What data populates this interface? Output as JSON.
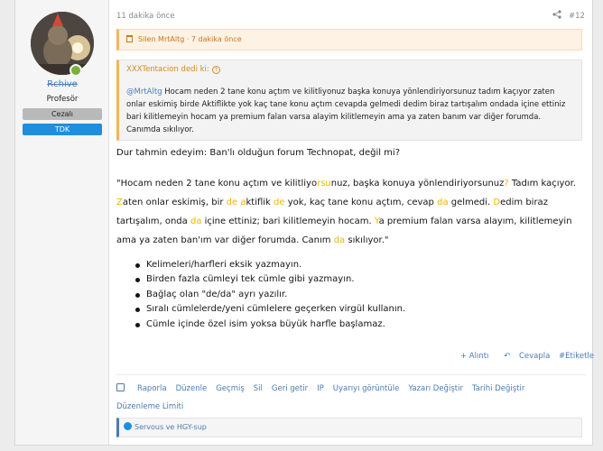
{
  "user": {
    "name": "Rchive",
    "title": "Profesör",
    "banner_banned": "Cezalı",
    "banner_tdk": "TDK"
  },
  "meta": {
    "time": "11 dakika önce",
    "number": "#12"
  },
  "deleted": {
    "text": "Silen MrtAltg · 7 dakika önce"
  },
  "quote": {
    "author": "XXXTentacion dedi ki:",
    "mention": "@MrtAltg",
    "line1": " Hocam neden 2 tane konu açtım ve kilitliyonuz başka konuya yönlendiriyorsunuz tadım kaçıyor zaten",
    "line2": "onlar eskimiş birde Aktiflikte yok kaç tane konu açtım cevapda gelmedi dedim biraz tartışalım ondada içine ettiniz",
    "line3": "bari kilitlemeyin hocam ya premium falan varsa alayim kilitlemeyin ama ya zaten banım var diğer forumda.",
    "line4": "Canımda sıkılıyor."
  },
  "body": {
    "intro": "Dur tahmin edeyim: Ban'lı olduğun forum Technopat, değil mi?",
    "p1": "\"Hocam neden 2 tane konu açtım ve kilitliyo",
    "p1_hl": "rsu",
    "p2": "nuz, başka konuya yönlendiriyorsunuz",
    "p2_hl": "?",
    "p3": " Tadım kaçıyor.",
    "p4_hl": "Z",
    "p4": "aten onlar eskimiş, bir ",
    "p5_hl": "de a",
    "p5": "ktiflik ",
    "p6_hl": "de",
    "p6": " yok, kaç tane konu açtım, cevap ",
    "p7_hl": "da",
    "p7": " gelmedi. ",
    "p8_hl": "D",
    "p8": "edim biraz",
    "p9": "tartışalım, onda ",
    "p9_hl": "da",
    "p10": " içine ettiniz; bari kilitlemeyin hocam. ",
    "p11_hl": "Y",
    "p11": "a premium falan varsa alayım, kilitlemeyin",
    "p12": "ama ya zaten ban'ım var diğer forumda. Canım ",
    "p12_hl": "da",
    "p13": " sıkılıyor.\""
  },
  "tips": [
    "Kelimeleri/harfleri eksik yazmayın.",
    "Birden fazla cümleyi tek cümle gibi yazmayın.",
    "Bağlaç olan \"de/da\" ayrı yazılır.",
    "Sıralı cümlelerde/yeni cümlelere geçerken virgül kullanın.",
    "Cümle içinde özel isim yoksa büyük harfle başlamaz."
  ],
  "reactions": {
    "quote": "+ Alıntı",
    "reply": "Cevapla",
    "tag": "#Etiketle"
  },
  "actions": [
    "Raporla",
    "Düzenle",
    "Geçmiş",
    "Sil",
    "Geri getir",
    "IP",
    "Uyarıyı görüntüle",
    "Yazarı Değiştir",
    "Tarihi Değiştir",
    "Düzenleme Limiti"
  ],
  "likes": {
    "text": "Servous ve HGY-sup"
  },
  "colors": {
    "accent": "#4a7bb5",
    "quote_border": "#f4b45a",
    "highlight": "#f4b400",
    "tdk": "#1e8fe0"
  }
}
